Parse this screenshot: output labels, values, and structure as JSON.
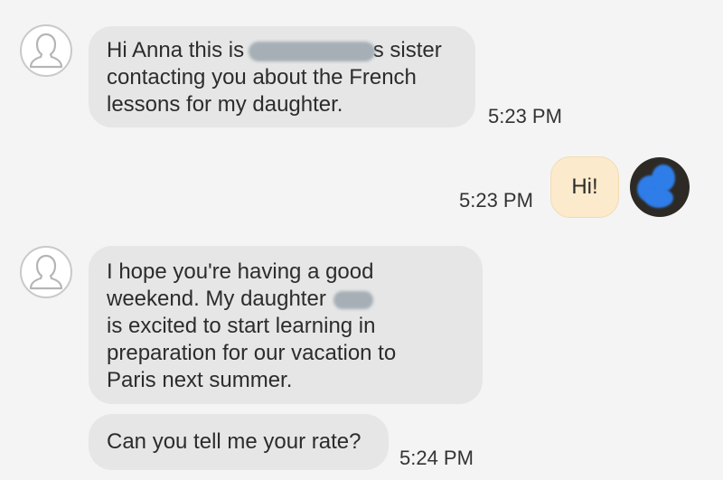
{
  "messages": {
    "m1": {
      "line1_start": "Hi Anna this is",
      "line1_end": "s sister",
      "line2": "contacting you about the French",
      "line3": "lessons for my daughter.",
      "time": "5:23 PM"
    },
    "m2": {
      "text": "Hi!",
      "time": "5:23 PM"
    },
    "m3": {
      "line1": "I hope you're having a good",
      "line2": "weekend. My daughter",
      "line3": "is excited to start learning  in",
      "line4": "preparation for our vacation to",
      "line5": "Paris next summer."
    },
    "m4": {
      "text": "Can you tell me your rate?",
      "time": "5:24 PM"
    }
  },
  "icons": {
    "contact_avatar": "person-outline-icon",
    "user_avatar": "profile-photo"
  },
  "colors": {
    "background": "#f4f4f4",
    "incoming_bubble": "#e6e6e6",
    "outgoing_bubble": "#fbeacb",
    "redaction": "#9aa6ad",
    "self_avatar_accent": "#2f7de8"
  }
}
